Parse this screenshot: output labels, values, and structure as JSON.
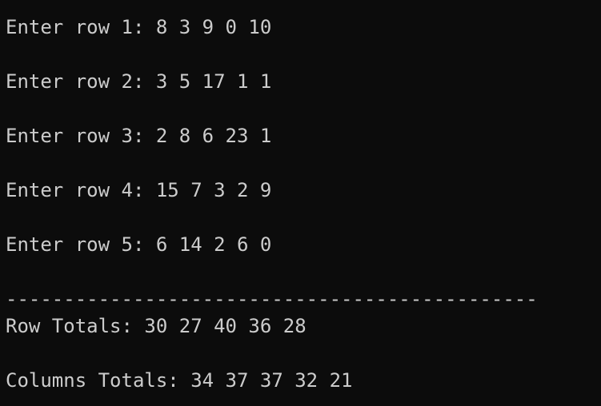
{
  "console": {
    "lines": {
      "row1": "Enter row 1: 8 3 9 0 10",
      "row2": "Enter row 2: 3 5 17 1 1",
      "row3": "Enter row 3: 2 8 6 23 1",
      "row4": "Enter row 4: 15 7 3 2 9",
      "row5": "Enter row 5: 6 14 2 6 0",
      "separator": "----------------------------------------------",
      "row_totals": "Row Totals: 30 27 40 36 28",
      "column_totals": "Columns Totals: 34 37 37 32 21"
    },
    "colors": {
      "background": "#0c0c0c",
      "text": "#cccccc"
    }
  }
}
